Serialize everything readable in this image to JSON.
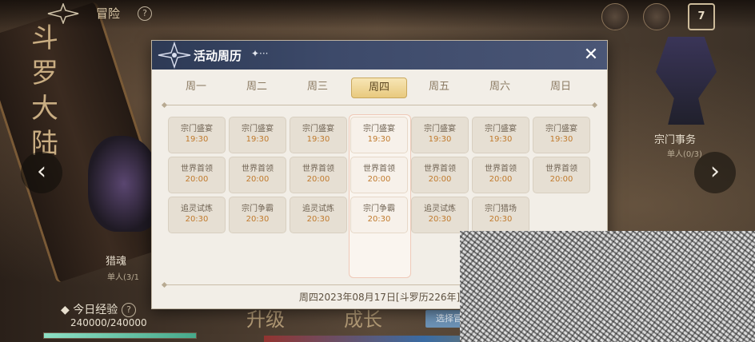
{
  "top_bar": {
    "title": "冒险",
    "help": "?",
    "calendar_day": "7"
  },
  "banner": {
    "text": "斗罗大陆"
  },
  "side_left": {
    "label": "猎魂",
    "sub": "单人(3/1"
  },
  "side_right": {
    "label": "宗门事务",
    "sub": "单人(0/3)"
  },
  "experience": {
    "label": "今日经验",
    "value": "240000/240000",
    "progress": 1.0
  },
  "bottom_buttons": {
    "upgrade": "升级",
    "growth": "成长",
    "guide": "选择冒险成长"
  },
  "modal": {
    "title": "活动周历",
    "dots": "✦···",
    "close": "✕",
    "active_day": 3,
    "days": [
      "周一",
      "周二",
      "周三",
      "周四",
      "周五",
      "周六",
      "周日"
    ],
    "schedule": [
      [
        {
          "name": "宗门盛宴",
          "time": "19:30"
        },
        {
          "name": "世界首领",
          "time": "20:00"
        },
        {
          "name": "追灵试炼",
          "time": "20:30"
        }
      ],
      [
        {
          "name": "宗门盛宴",
          "time": "19:30"
        },
        {
          "name": "世界首领",
          "time": "20:00"
        },
        {
          "name": "宗门争霸",
          "time": "20:30"
        }
      ],
      [
        {
          "name": "宗门盛宴",
          "time": "19:30"
        },
        {
          "name": "世界首领",
          "time": "20:00"
        },
        {
          "name": "追灵试炼",
          "time": "20:30"
        }
      ],
      [
        {
          "name": "宗门盛宴",
          "time": "19:30"
        },
        {
          "name": "世界首领",
          "time": "20:00"
        },
        {
          "name": "宗门争霸",
          "time": "20:30"
        }
      ],
      [
        {
          "name": "宗门盛宴",
          "time": "19:30"
        },
        {
          "name": "世界首领",
          "time": "20:00"
        },
        {
          "name": "追灵试炼",
          "time": "20:30"
        }
      ],
      [
        {
          "name": "宗门盛宴",
          "time": "19:30"
        },
        {
          "name": "世界首领",
          "time": "20:00"
        },
        {
          "name": "宗门猎场",
          "time": "20:30"
        }
      ],
      [
        {
          "name": "宗门盛宴",
          "time": "19:30"
        },
        {
          "name": "世界首领",
          "time": "20:00"
        }
      ]
    ],
    "footer": "周四2023年08月17日[斗罗历226年]"
  }
}
